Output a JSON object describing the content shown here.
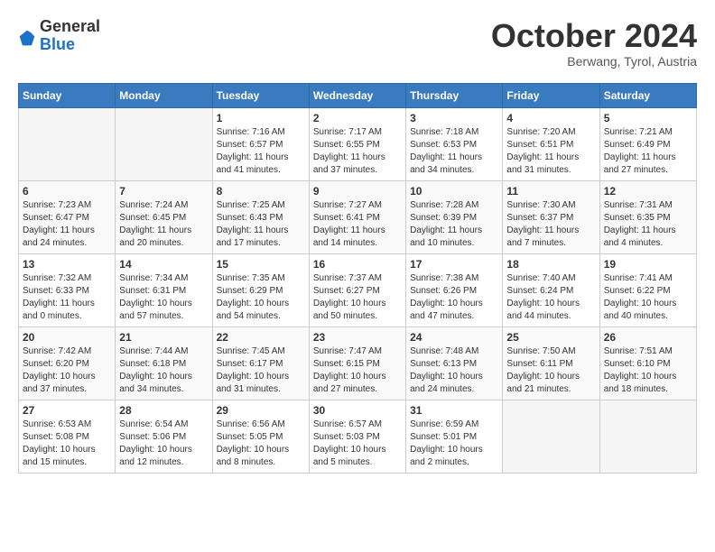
{
  "header": {
    "logo": {
      "general": "General",
      "blue": "Blue"
    },
    "title": "October 2024",
    "subtitle": "Berwang, Tyrol, Austria"
  },
  "calendar": {
    "weekdays": [
      "Sunday",
      "Monday",
      "Tuesday",
      "Wednesday",
      "Thursday",
      "Friday",
      "Saturday"
    ],
    "weeks": [
      [
        {
          "day": "",
          "info": ""
        },
        {
          "day": "",
          "info": ""
        },
        {
          "day": "1",
          "info": "Sunrise: 7:16 AM\nSunset: 6:57 PM\nDaylight: 11 hours and 41 minutes."
        },
        {
          "day": "2",
          "info": "Sunrise: 7:17 AM\nSunset: 6:55 PM\nDaylight: 11 hours and 37 minutes."
        },
        {
          "day": "3",
          "info": "Sunrise: 7:18 AM\nSunset: 6:53 PM\nDaylight: 11 hours and 34 minutes."
        },
        {
          "day": "4",
          "info": "Sunrise: 7:20 AM\nSunset: 6:51 PM\nDaylight: 11 hours and 31 minutes."
        },
        {
          "day": "5",
          "info": "Sunrise: 7:21 AM\nSunset: 6:49 PM\nDaylight: 11 hours and 27 minutes."
        }
      ],
      [
        {
          "day": "6",
          "info": "Sunrise: 7:23 AM\nSunset: 6:47 PM\nDaylight: 11 hours and 24 minutes."
        },
        {
          "day": "7",
          "info": "Sunrise: 7:24 AM\nSunset: 6:45 PM\nDaylight: 11 hours and 20 minutes."
        },
        {
          "day": "8",
          "info": "Sunrise: 7:25 AM\nSunset: 6:43 PM\nDaylight: 11 hours and 17 minutes."
        },
        {
          "day": "9",
          "info": "Sunrise: 7:27 AM\nSunset: 6:41 PM\nDaylight: 11 hours and 14 minutes."
        },
        {
          "day": "10",
          "info": "Sunrise: 7:28 AM\nSunset: 6:39 PM\nDaylight: 11 hours and 10 minutes."
        },
        {
          "day": "11",
          "info": "Sunrise: 7:30 AM\nSunset: 6:37 PM\nDaylight: 11 hours and 7 minutes."
        },
        {
          "day": "12",
          "info": "Sunrise: 7:31 AM\nSunset: 6:35 PM\nDaylight: 11 hours and 4 minutes."
        }
      ],
      [
        {
          "day": "13",
          "info": "Sunrise: 7:32 AM\nSunset: 6:33 PM\nDaylight: 11 hours and 0 minutes."
        },
        {
          "day": "14",
          "info": "Sunrise: 7:34 AM\nSunset: 6:31 PM\nDaylight: 10 hours and 57 minutes."
        },
        {
          "day": "15",
          "info": "Sunrise: 7:35 AM\nSunset: 6:29 PM\nDaylight: 10 hours and 54 minutes."
        },
        {
          "day": "16",
          "info": "Sunrise: 7:37 AM\nSunset: 6:27 PM\nDaylight: 10 hours and 50 minutes."
        },
        {
          "day": "17",
          "info": "Sunrise: 7:38 AM\nSunset: 6:26 PM\nDaylight: 10 hours and 47 minutes."
        },
        {
          "day": "18",
          "info": "Sunrise: 7:40 AM\nSunset: 6:24 PM\nDaylight: 10 hours and 44 minutes."
        },
        {
          "day": "19",
          "info": "Sunrise: 7:41 AM\nSunset: 6:22 PM\nDaylight: 10 hours and 40 minutes."
        }
      ],
      [
        {
          "day": "20",
          "info": "Sunrise: 7:42 AM\nSunset: 6:20 PM\nDaylight: 10 hours and 37 minutes."
        },
        {
          "day": "21",
          "info": "Sunrise: 7:44 AM\nSunset: 6:18 PM\nDaylight: 10 hours and 34 minutes."
        },
        {
          "day": "22",
          "info": "Sunrise: 7:45 AM\nSunset: 6:17 PM\nDaylight: 10 hours and 31 minutes."
        },
        {
          "day": "23",
          "info": "Sunrise: 7:47 AM\nSunset: 6:15 PM\nDaylight: 10 hours and 27 minutes."
        },
        {
          "day": "24",
          "info": "Sunrise: 7:48 AM\nSunset: 6:13 PM\nDaylight: 10 hours and 24 minutes."
        },
        {
          "day": "25",
          "info": "Sunrise: 7:50 AM\nSunset: 6:11 PM\nDaylight: 10 hours and 21 minutes."
        },
        {
          "day": "26",
          "info": "Sunrise: 7:51 AM\nSunset: 6:10 PM\nDaylight: 10 hours and 18 minutes."
        }
      ],
      [
        {
          "day": "27",
          "info": "Sunrise: 6:53 AM\nSunset: 5:08 PM\nDaylight: 10 hours and 15 minutes."
        },
        {
          "day": "28",
          "info": "Sunrise: 6:54 AM\nSunset: 5:06 PM\nDaylight: 10 hours and 12 minutes."
        },
        {
          "day": "29",
          "info": "Sunrise: 6:56 AM\nSunset: 5:05 PM\nDaylight: 10 hours and 8 minutes."
        },
        {
          "day": "30",
          "info": "Sunrise: 6:57 AM\nSunset: 5:03 PM\nDaylight: 10 hours and 5 minutes."
        },
        {
          "day": "31",
          "info": "Sunrise: 6:59 AM\nSunset: 5:01 PM\nDaylight: 10 hours and 2 minutes."
        },
        {
          "day": "",
          "info": ""
        },
        {
          "day": "",
          "info": ""
        }
      ]
    ]
  }
}
